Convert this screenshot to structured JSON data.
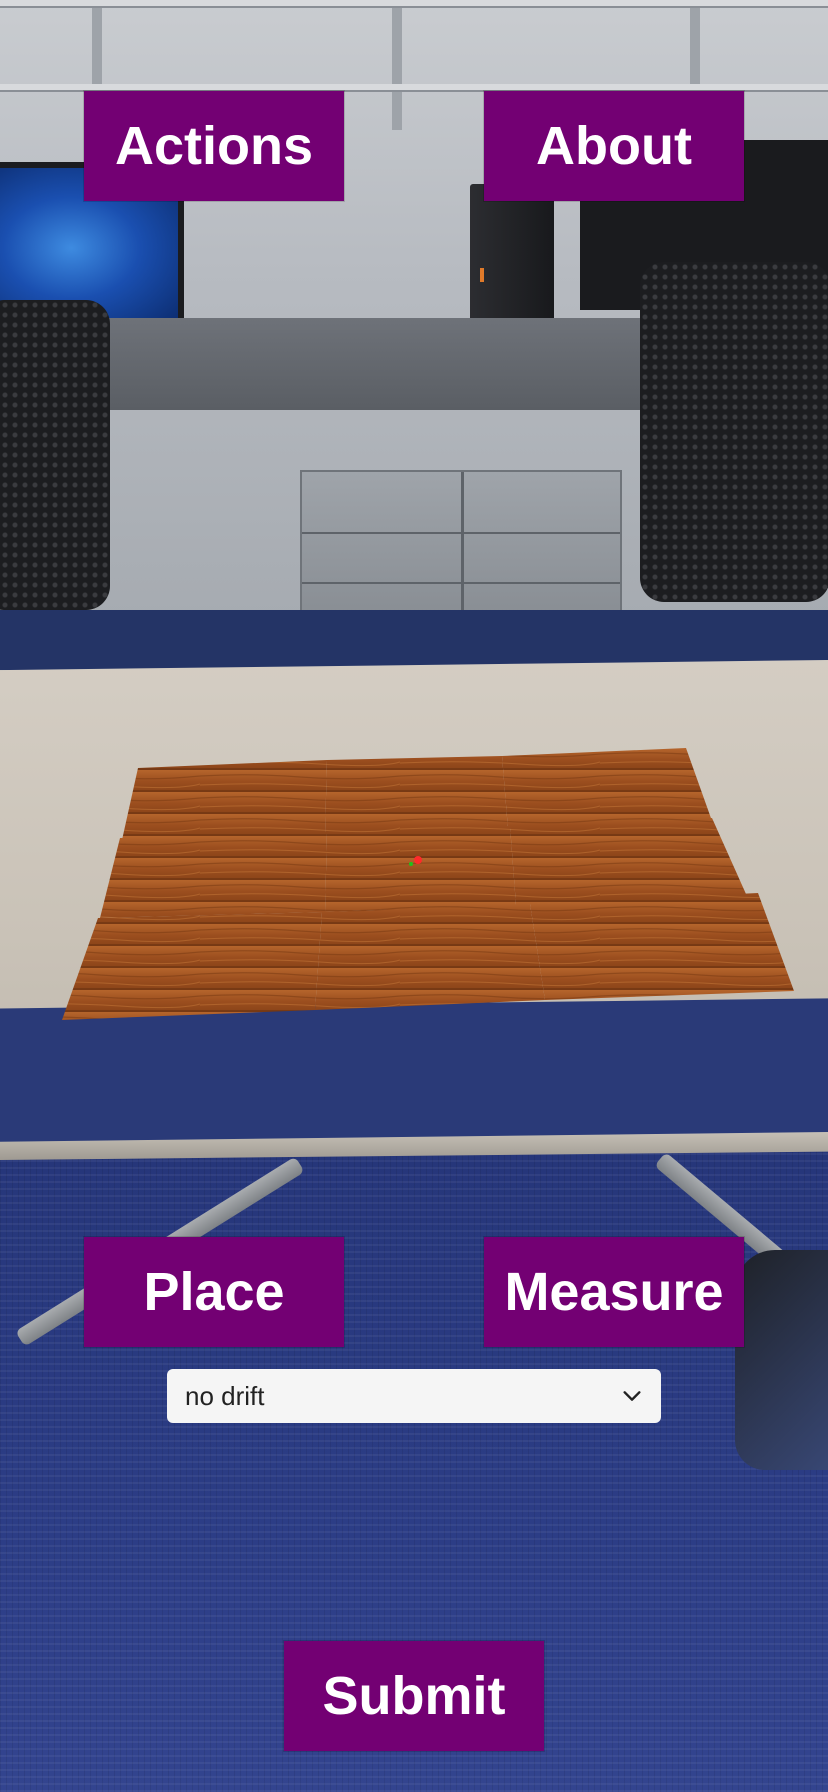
{
  "header": {
    "actions_label": "Actions",
    "about_label": "About"
  },
  "controls": {
    "place_label": "Place",
    "measure_label": "Measure",
    "drift_select": {
      "selected": "no drift"
    },
    "submit_label": "Submit"
  },
  "colors": {
    "button_bg": "#730073",
    "button_text": "#ffffff",
    "select_bg": "#f5f5f5"
  },
  "icons": {
    "dropdown": "chevron-down-icon"
  }
}
